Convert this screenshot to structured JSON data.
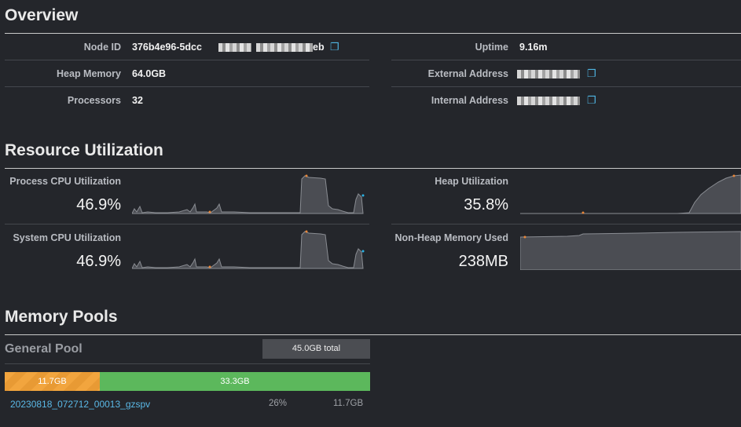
{
  "overview": {
    "title": "Overview",
    "node_id_label": "Node ID",
    "node_id_value_start": "376b4e96-5dcc",
    "node_id_value_end": "eb",
    "heap_memory_label": "Heap Memory",
    "heap_memory_value": "64.0GB",
    "processors_label": "Processors",
    "processors_value": "32",
    "uptime_label": "Uptime",
    "uptime_value": "9.16m",
    "external_address_label": "External Address",
    "internal_address_label": "Internal Address",
    "copy_icon": "clipboard-copy-icon"
  },
  "resource": {
    "title": "Resource Utilization",
    "process_cpu_label": "Process CPU Utilization",
    "process_cpu_value": "46.9%",
    "system_cpu_label": "System CPU Utilization",
    "system_cpu_value": "46.9%",
    "heap_util_label": "Heap Utilization",
    "heap_util_value": "35.8%",
    "non_heap_label": "Non-Heap Memory Used",
    "non_heap_value": "238MB",
    "sparkline_fill": "#4b4d53",
    "sparkline_stroke": "#8a8d93",
    "min_marker_color": "#e8873a",
    "max_marker_color": "#e8873a",
    "current_marker_color": "#2bb4e6"
  },
  "memory": {
    "title": "Memory Pools",
    "pool_name": "General Pool",
    "pool_total": "45.0GB total",
    "reserved_value": "11.7GB",
    "free_value": "33.3GB",
    "query_id": "20230818_072712_00013_gzspv",
    "query_pct": "26%",
    "query_size": "11.7GB",
    "reserved_fraction": 0.26,
    "reserved_color": "#f2a53e",
    "free_color": "#5cb85c"
  }
}
